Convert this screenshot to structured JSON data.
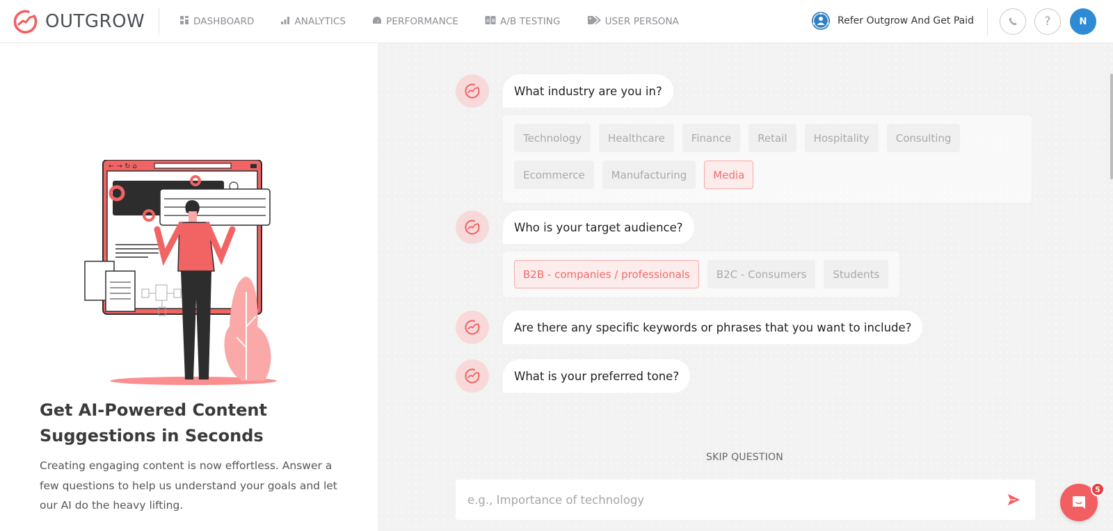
{
  "header": {
    "brand": "OUTGROW",
    "nav": [
      {
        "label": "DASHBOARD",
        "icon": "dashboard-grid-icon"
      },
      {
        "label": "ANALYTICS",
        "icon": "bar-chart-icon"
      },
      {
        "label": "PERFORMANCE",
        "icon": "speedometer-icon"
      },
      {
        "label": "A/B TESTING",
        "icon": "ab-test-icon"
      },
      {
        "label": "USER PERSONA",
        "icon": "tags-icon"
      }
    ],
    "refer_label": "Refer Outgrow And Get Paid",
    "avatar_initial": "N",
    "help_glyph": "?"
  },
  "intro": {
    "title": "Get AI-Powered Content Suggestions in Seconds",
    "description": "Creating engaging content is now effortless. Answer a few questions to help us understand your goals and let our AI do the heavy lifting."
  },
  "chat": {
    "questions": [
      {
        "text": "What industry are you in?",
        "option_rows": [
          [
            "Technology",
            "Healthcare",
            "Finance",
            "Retail",
            "Hospitality",
            "Consulting"
          ],
          [
            "Ecommerce",
            "Manufacturing",
            "Media"
          ]
        ],
        "selected": "Media"
      },
      {
        "text": "Who is your target audience?",
        "option_rows": [
          [
            "B2B - companies / professionals",
            "B2C - Consumers",
            "Students"
          ]
        ],
        "selected": "B2B - companies / professionals"
      },
      {
        "text": "Are there any specific keywords or phrases that you want to include?"
      },
      {
        "text": "What is your preferred tone?"
      }
    ],
    "skip_label": "SKIP QUESTION",
    "input_value": "",
    "input_placeholder": "e.g., Importance of technology"
  },
  "support": {
    "unread_count": "5"
  },
  "colors": {
    "brand": "#f25f62",
    "avatar": "#2f8ad6",
    "nav_text": "#8a8d92"
  }
}
